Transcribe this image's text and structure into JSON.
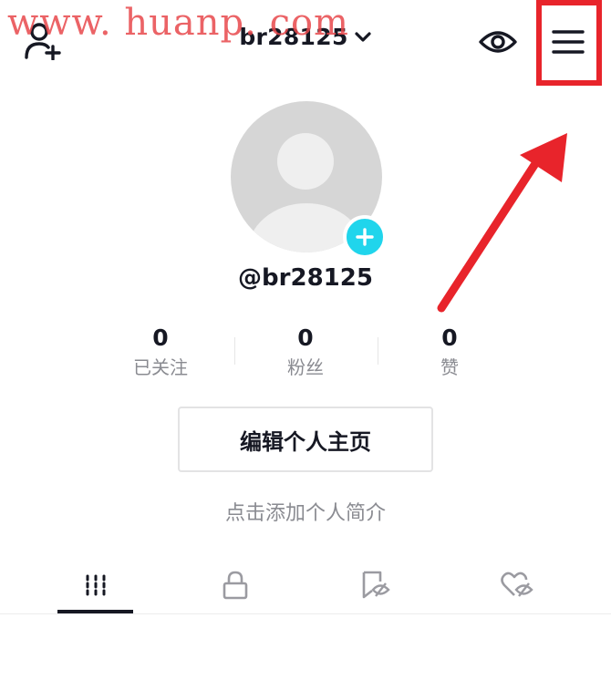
{
  "watermark": "www. huanp. com",
  "header": {
    "username": "br28125",
    "icons": {
      "add_friend": "add-friend-icon",
      "dropdown": "chevron-down-icon",
      "eye": "eye-icon",
      "menu": "menu-icon"
    }
  },
  "profile": {
    "handle": "@br28125",
    "avatar_add_icon": "plus-icon"
  },
  "stats": [
    {
      "value": "0",
      "label": "已关注"
    },
    {
      "value": "0",
      "label": "粉丝"
    },
    {
      "value": "0",
      "label": "赞"
    }
  ],
  "edit_button": "编辑个人主页",
  "bio_placeholder": "点击添加个人简介",
  "tabs": [
    {
      "icon": "videos-grid-icon",
      "active": true
    },
    {
      "icon": "lock-icon",
      "active": false
    },
    {
      "icon": "bookmark-hidden-icon",
      "active": false
    },
    {
      "icon": "heart-hidden-icon",
      "active": false
    }
  ],
  "annotation": {
    "highlight_color": "#e8242b",
    "arrow_color": "#e8242b"
  },
  "colors": {
    "accent": "#20d5ec",
    "text_primary": "#161823",
    "text_secondary": "#8a8b91"
  }
}
